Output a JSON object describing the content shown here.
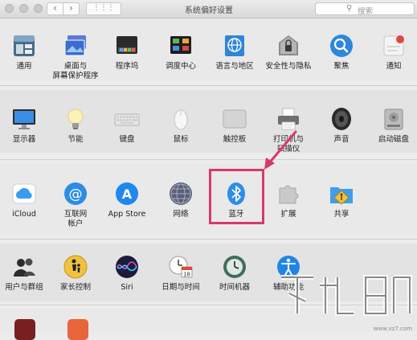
{
  "window": {
    "title": "系统偏好设置",
    "nav_back": "‹",
    "nav_forward": "›",
    "grid_glyph": "⋮⋮⋮",
    "search_placeholder": "搜索",
    "search_icon": "search-icon"
  },
  "sections": [
    {
      "items": [
        {
          "label": "通用",
          "icon": "general-icon"
        },
        {
          "label": "桌面与\n屏幕保护程序",
          "icon": "desktop-screensaver-icon"
        },
        {
          "label": "程序坞",
          "icon": "dock-icon"
        },
        {
          "label": "调度中心",
          "icon": "mission-control-icon"
        },
        {
          "label": "语言与地区",
          "icon": "language-region-icon"
        },
        {
          "label": "安全性与隐私",
          "icon": "security-privacy-icon"
        },
        {
          "label": "聚焦",
          "icon": "spotlight-icon"
        },
        {
          "label": "通知",
          "icon": "notifications-icon"
        }
      ]
    },
    {
      "items": [
        {
          "label": "显示器",
          "icon": "displays-icon"
        },
        {
          "label": "节能",
          "icon": "energy-saver-icon"
        },
        {
          "label": "键盘",
          "icon": "keyboard-icon"
        },
        {
          "label": "鼠标",
          "icon": "mouse-icon"
        },
        {
          "label": "触控板",
          "icon": "trackpad-icon"
        },
        {
          "label": "打印机与\n扫描仪",
          "icon": "printers-scanners-icon"
        },
        {
          "label": "声音",
          "icon": "sound-icon"
        },
        {
          "label": "启动磁盘",
          "icon": "startup-disk-icon"
        }
      ]
    },
    {
      "items": [
        {
          "label": "iCloud",
          "icon": "icloud-icon"
        },
        {
          "label": "互联网\n帐户",
          "icon": "internet-accounts-icon"
        },
        {
          "label": "App Store",
          "icon": "app-store-icon"
        },
        {
          "label": "网络",
          "icon": "network-icon"
        },
        {
          "label": "蓝牙",
          "icon": "bluetooth-icon"
        },
        {
          "label": "扩展",
          "icon": "extensions-icon"
        },
        {
          "label": "共享",
          "icon": "sharing-icon"
        }
      ]
    },
    {
      "items": [
        {
          "label": "用户与群组",
          "icon": "users-groups-icon"
        },
        {
          "label": "家长控制",
          "icon": "parental-controls-icon"
        },
        {
          "label": "Siri",
          "icon": "siri-icon"
        },
        {
          "label": "日期与时间",
          "icon": "date-time-icon"
        },
        {
          "label": "时间机器",
          "icon": "time-machine-icon"
        },
        {
          "label": "辅助功能",
          "icon": "accessibility-icon"
        }
      ]
    }
  ],
  "icon_glyphs": {
    "calendar_day": "18",
    "at_sign": "@",
    "app_store_a": "A",
    "bluetooth_b": "ᛒ",
    "spotlight_q": "⚲",
    "accessibility_figure": "♿"
  },
  "highlight_color": "#d8396a",
  "watermark_caption": "www.xz7.com"
}
